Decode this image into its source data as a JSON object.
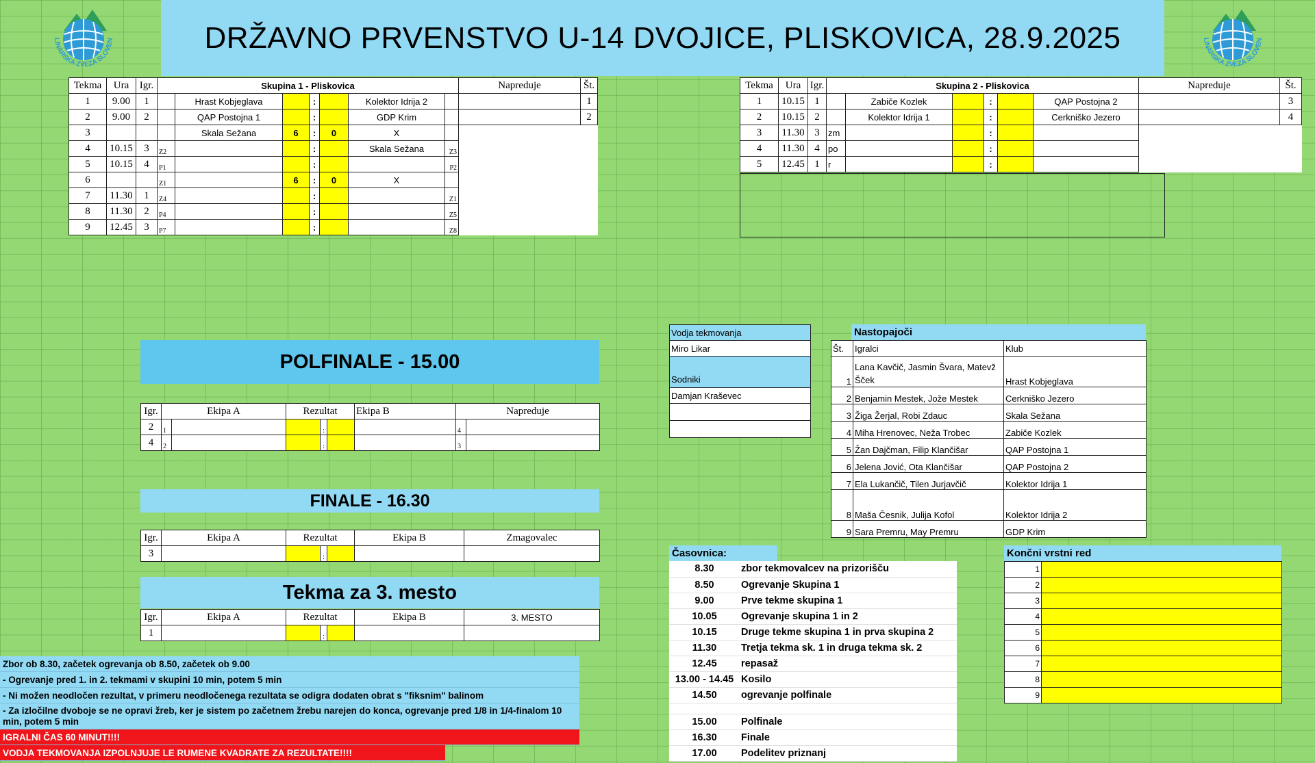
{
  "title": "DRŽAVNO PRVENSTVO U-14 DVOJICE, PLISKOVICA, 28.9.2025",
  "logo": {
    "text": "BALINARSKA ZVEZA SLOVENIJE",
    "colors": [
      "#2f9bd6",
      "#2e9e5a"
    ]
  },
  "group1": {
    "headers": {
      "tekma": "Tekma",
      "ura": "Ura",
      "igr": "Igr.",
      "title": "Skupina 1 - Pliskovica",
      "napreduje": "Napreduje",
      "st": "Št."
    },
    "rows": [
      {
        "tekma": "1",
        "ura": "9.00",
        "igr": "1",
        "pa": "",
        "a": "Hrast Kobjeglava",
        "sa": "",
        "sep": ":",
        "sb": "",
        "b": "Kolektor Idrija 2",
        "pb": "",
        "st": "1"
      },
      {
        "tekma": "2",
        "ura": "9.00",
        "igr": "2",
        "pa": "",
        "a": "QAP Postojna 1",
        "sa": "",
        "sep": ":",
        "sb": "",
        "b": "GDP Krim",
        "pb": "",
        "st": "2"
      },
      {
        "tekma": "3",
        "ura": "",
        "igr": "",
        "pa": "",
        "a": "Skala Sežana",
        "sa": "6",
        "sep": ":",
        "sb": "0",
        "b": "X",
        "pb": "",
        "st": ""
      },
      {
        "tekma": "4",
        "ura": "10.15",
        "igr": "3",
        "pa": "Z2",
        "a": "",
        "sa": "",
        "sep": ":",
        "sb": "",
        "b": "Skala Sežana",
        "pb": "Z3",
        "st": ""
      },
      {
        "tekma": "5",
        "ura": "10.15",
        "igr": "4",
        "pa": "P1",
        "a": "",
        "sa": "",
        "sep": ":",
        "sb": "",
        "b": "",
        "pb": "P2",
        "st": ""
      },
      {
        "tekma": "6",
        "ura": "",
        "igr": "",
        "pa": "Z1",
        "a": "",
        "sa": "6",
        "sep": ":",
        "sb": "0",
        "b": "X",
        "pb": "",
        "st": ""
      },
      {
        "tekma": "7",
        "ura": "11.30",
        "igr": "1",
        "pa": "Z4",
        "a": "",
        "sa": "",
        "sep": ":",
        "sb": "",
        "b": "",
        "pb": "Z1",
        "st": ""
      },
      {
        "tekma": "8",
        "ura": "11.30",
        "igr": "2",
        "pa": "P4",
        "a": "",
        "sa": "",
        "sep": ":",
        "sb": "",
        "b": "",
        "pb": "Z5",
        "st": ""
      },
      {
        "tekma": "9",
        "ura": "12.45",
        "igr": "3",
        "pa": "P7",
        "a": "",
        "sa": "",
        "sep": ":",
        "sb": "",
        "b": "",
        "pb": "Z8",
        "st": ""
      }
    ]
  },
  "group2": {
    "headers": {
      "tekma": "Tekma",
      "ura": "Ura",
      "igr": "Igr.",
      "title": "Skupina 2 - Pliskovica",
      "napreduje": "Napreduje",
      "st": "Št."
    },
    "rows": [
      {
        "tekma": "1",
        "ura": "10.15",
        "igr": "1",
        "pa": "",
        "a": "Zabiče Kozlek",
        "sa": "",
        "sep": ":",
        "sb": "",
        "b": "QAP Postojna 2",
        "st": "3"
      },
      {
        "tekma": "2",
        "ura": "10.15",
        "igr": "2",
        "pa": "",
        "a": "Kolektor Idrija 1",
        "sa": "",
        "sep": ":",
        "sb": "",
        "b": "Cerkniško Jezero",
        "st": "4"
      },
      {
        "tekma": "3",
        "ura": "11.30",
        "igr": "3",
        "pa": "zm",
        "a": "",
        "sa": "",
        "sep": ":",
        "sb": "",
        "b": "",
        "st": ""
      },
      {
        "tekma": "4",
        "ura": "11.30",
        "igr": "4",
        "pa": "po",
        "a": "",
        "sa": "",
        "sep": ":",
        "sb": "",
        "b": "",
        "st": ""
      },
      {
        "tekma": "5",
        "ura": "12.45",
        "igr": "1",
        "pa": "r",
        "a": "",
        "sa": "",
        "sep": ":",
        "sb": "",
        "b": "",
        "st": ""
      }
    ]
  },
  "polfinale": {
    "title": "POLFINALE - 15.00",
    "headers": {
      "igr": "Igr.",
      "a": "Ekipa A",
      "rez": "Rezultat",
      "b": "Ekipa B",
      "nap": "Napreduje"
    },
    "rows": [
      {
        "igr": "2",
        "pa": "1",
        "sep": ":",
        "pb": "4"
      },
      {
        "igr": "4",
        "pa": "2",
        "sep": ":",
        "pb": "3"
      }
    ]
  },
  "finale": {
    "title": "FINALE - 16.30",
    "headers": {
      "igr": "Igr.",
      "a": "Ekipa A",
      "rez": "Rezultat",
      "b": "Ekipa B",
      "win": "Zmagovalec"
    },
    "rows": [
      {
        "igr": "3",
        "sep": ":"
      }
    ]
  },
  "third": {
    "title": "Tekma za 3. mesto",
    "headers": {
      "igr": "Igr.",
      "a": "Ekipa A",
      "rez": "Rezultat",
      "b": "Ekipa B",
      "place": "3. MESTO"
    },
    "rows": [
      {
        "igr": "1",
        "sep": ":"
      }
    ]
  },
  "officials": {
    "leader_label": "Vodja tekmovanja",
    "leader": "Miro Likar",
    "referee_label": "Sodniki",
    "referee": "Damjan Kraševec"
  },
  "players": {
    "title": "Nastopajoči",
    "headers": {
      "st": "Št.",
      "igralci": "Igralci",
      "klub": "Klub"
    },
    "rows": [
      {
        "st": "1",
        "igralci": "Lana Kavčič, Jasmin Švara, Matevž Šček",
        "klub": "Hrast Kobjeglava"
      },
      {
        "st": "2",
        "igralci": "Benjamin Mestek, Jože Mestek",
        "klub": "Cerkniško Jezero"
      },
      {
        "st": "3",
        "igralci": "Žiga Žerjal, Robi Zdauc",
        "klub": "Skala Sežana"
      },
      {
        "st": "4",
        "igralci": "Miha Hrenovec, Neža Trobec",
        "klub": "Zabiče Kozlek"
      },
      {
        "st": "5",
        "igralci": "Žan Dajčman, Filip Klančišar",
        "klub": "QAP Postojna 1"
      },
      {
        "st": "6",
        "igralci": "Jelena Jović, Ota Klančišar",
        "klub": "QAP Postojna 2"
      },
      {
        "st": "7",
        "igralci": "Ela Lukančič, Tilen Jurjavčič",
        "klub": "Kolektor Idrija 1"
      },
      {
        "st": "8",
        "igralci": "Maša Česnik, Julija Kofol",
        "klub": "Kolektor Idrija 2"
      },
      {
        "st": "9",
        "igralci": "Sara Premru, May Premru",
        "klub": "GDP Krim"
      }
    ]
  },
  "timetable": {
    "title": "Časovnica:",
    "rows": [
      {
        "time": "8.30",
        "event": "zbor tekmovalcev na prizorišču"
      },
      {
        "time": "8.50",
        "event": "Ogrevanje Skupina 1"
      },
      {
        "time": "9.00",
        "event": "Prve tekme skupina 1"
      },
      {
        "time": "10.05",
        "event": "Ogrevanje skupina 1 in 2"
      },
      {
        "time": "10.15",
        "event": "Druge tekme skupina 1 in prva skupina 2"
      },
      {
        "time": "11.30",
        "event": "Tretja tekma sk. 1 in druga tekma sk. 2"
      },
      {
        "time": "12.45",
        "event": "repasaž"
      },
      {
        "time": "13.00 - 14.45",
        "event": "Kosilo"
      },
      {
        "time": "14.50",
        "event": "ogrevanje polfinale"
      },
      {
        "time": "",
        "event": ""
      },
      {
        "time": "15.00",
        "event": "Polfinale"
      },
      {
        "time": "16.30",
        "event": "Finale"
      },
      {
        "time": "17.00",
        "event": "Podelitev priznanj"
      }
    ]
  },
  "ranking": {
    "title": "Končni vrstni red",
    "places": [
      "1",
      "2",
      "3",
      "4",
      "5",
      "6",
      "7",
      "8",
      "9"
    ]
  },
  "notes": [
    "Zbor ob 8.30, začetek ogrevanja ob 8.50, začetek ob 9.00",
    "- Ogrevanje pred 1.  in 2. tekmami v skupini 10 min, potem 5 min",
    "- Ni možen neodločen rezultat, v primeru neodločenega rezultata se odigra dodaten obrat s \"fiksnim\" balinom",
    "- Za izločilne dvoboje se ne opravi žreb, ker je sistem po začetnem žrebu narejen do konca, ogrevanje pred 1/8 in 1/4-finalom 10 min, potem 5 min"
  ],
  "warnings": [
    "IGRALNI ČAS 60 MINUT!!!!",
    "VODJA TEKMOVANJA IZPOLNJUJE LE RUMENE KVADRATE ZA REZULTATE!!!!"
  ],
  "colors": {
    "grid_bg": "#93d873",
    "header_blue": "#92d9f4",
    "polfinale_blue": "#5fc6ee",
    "score_yellow": "#ffff00",
    "warning_red": "#f0151a"
  }
}
